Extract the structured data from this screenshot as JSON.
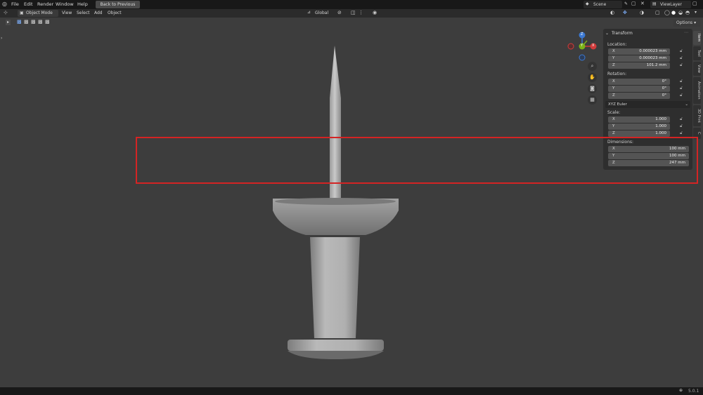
{
  "topbar": {
    "menus": [
      "File",
      "Edit",
      "Render",
      "Window",
      "Help"
    ],
    "back_button": "Back to Previous",
    "scene": "Scene",
    "view_layer": "ViewLayer"
  },
  "toolbar": {
    "mode": "Object Mode",
    "menus": [
      "View",
      "Select",
      "Add",
      "Object"
    ],
    "orientation": "Global",
    "options": "Options"
  },
  "gizmo": {
    "x": "X",
    "y": "Y",
    "z": "Z"
  },
  "npanel": {
    "header": "Transform",
    "location_label": "Location:",
    "location": [
      {
        "axis": "X",
        "value": "0.000023 mm"
      },
      {
        "axis": "Y",
        "value": "0.000023 mm"
      },
      {
        "axis": "Z",
        "value": "101.2 mm"
      }
    ],
    "rotation_label": "Rotation:",
    "rotation": [
      {
        "axis": "X",
        "value": "0°"
      },
      {
        "axis": "Y",
        "value": "0°"
      },
      {
        "axis": "Z",
        "value": "0°"
      }
    ],
    "rotation_mode": "XYZ Euler",
    "scale_label": "Scale:",
    "scale": [
      {
        "axis": "X",
        "value": "1.000"
      },
      {
        "axis": "Y",
        "value": "1.000"
      },
      {
        "axis": "Z",
        "value": "1.000"
      }
    ],
    "dimensions_label": "Dimensions:",
    "dimensions": [
      {
        "axis": "X",
        "value": "100 mm"
      },
      {
        "axis": "Y",
        "value": "100 mm"
      },
      {
        "axis": "Z",
        "value": "247 mm"
      }
    ],
    "tabs": [
      "Item",
      "Tool",
      "View",
      "Animation",
      "3D Print",
      "C"
    ]
  },
  "statusbar": {
    "version": "5.0.1"
  },
  "colors": {
    "highlight": "#d42424",
    "background": "#3d3d3d"
  }
}
